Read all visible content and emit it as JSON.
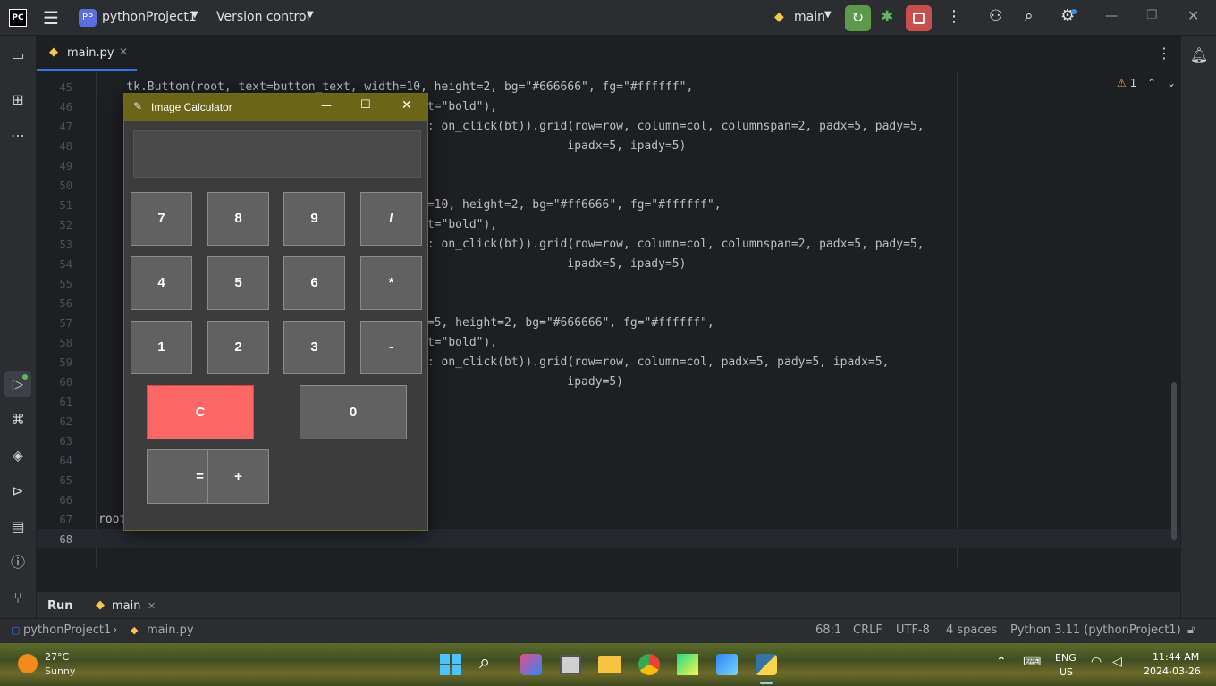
{
  "titlebar": {
    "logo": "PC",
    "project_badge": "PP",
    "project_name": "pythonProject1",
    "version_control": "Version control",
    "branch": "main"
  },
  "tab": {
    "label": "main.py"
  },
  "editor": {
    "warning_count": "1",
    "lines": [
      {
        "n": "45",
        "text": "    tk.Button(root, text=button_text, width=10, height=2, bg=\"#666666\", fg=\"#ffffff\","
      },
      {
        "n": "46",
        "text": "                                              ht=\"bold\"),"
      },
      {
        "n": "47",
        "text": "                                              t: on_click(bt)).grid(row=row, column=col, columnspan=2, padx=5, pady=5,"
      },
      {
        "n": "48",
        "text": "                                                                   ipadx=5, ipady=5)"
      },
      {
        "n": "49",
        "text": ""
      },
      {
        "n": "50",
        "text": ""
      },
      {
        "n": "51",
        "text": "                                              h=10, height=2, bg=\"#ff6666\", fg=\"#ffffff\","
      },
      {
        "n": "52",
        "text": "                                              ht=\"bold\"),"
      },
      {
        "n": "53",
        "text": "                                              t: on_click(bt)).grid(row=row, column=col, columnspan=2, padx=5, pady=5,"
      },
      {
        "n": "54",
        "text": "                                                                   ipadx=5, ipady=5)"
      },
      {
        "n": "55",
        "text": ""
      },
      {
        "n": "56",
        "text": ""
      },
      {
        "n": "57",
        "text": "                                              h=5, height=2, bg=\"#666666\", fg=\"#ffffff\","
      },
      {
        "n": "58",
        "text": "                                              ht=\"bold\"),"
      },
      {
        "n": "59",
        "text": "                                              t: on_click(bt)).grid(row=row, column=col, padx=5, pady=5, ipadx=5,"
      },
      {
        "n": "60",
        "text": "                                                                   ipady=5)"
      },
      {
        "n": "61",
        "text": ""
      },
      {
        "n": "62",
        "text": ""
      },
      {
        "n": "63",
        "text": ""
      },
      {
        "n": "64",
        "text": ""
      },
      {
        "n": "65",
        "text": ""
      },
      {
        "n": "66",
        "text": ""
      },
      {
        "n": "67",
        "text": "root"
      },
      {
        "n": "68",
        "text": ""
      }
    ]
  },
  "calculator": {
    "title": "Image Calculator",
    "display": "",
    "buttons": [
      "7",
      "8",
      "9",
      "/",
      "4",
      "5",
      "6",
      "*",
      "1",
      "2",
      "3",
      "-"
    ],
    "clear": "C",
    "zero": "0",
    "equals": "=",
    "plus": "+"
  },
  "runbar": {
    "run_label": "Run",
    "config": "main"
  },
  "statusbar": {
    "project": "pythonProject1",
    "file": "main.py",
    "position": "68:1",
    "line_sep": "CRLF",
    "encoding": "UTF-8",
    "indent": "4 spaces",
    "interpreter": "Python 3.11 (pythonProject1)"
  },
  "taskbar": {
    "weather_temp": "27°C",
    "weather_desc": "Sunny",
    "lang": "ENG",
    "region": "US",
    "time": "11:44 AM",
    "date": "2024-03-26"
  },
  "colors": {
    "accent_run": "#5b9a4b",
    "accent_stop": "#c94f4f",
    "calc_title": "#6b6617",
    "calc_red": "#ff6666"
  }
}
